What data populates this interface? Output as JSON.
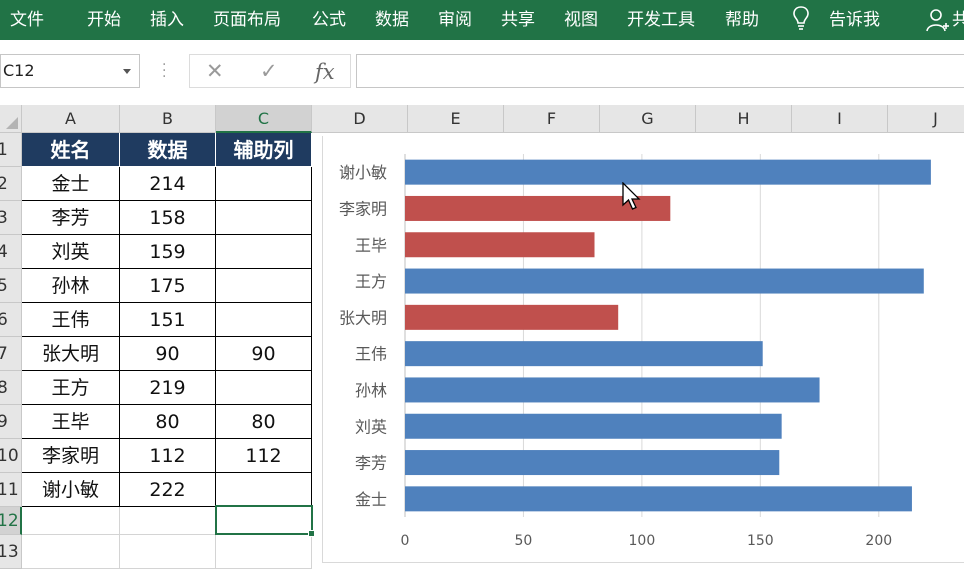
{
  "ribbon": {
    "tabs": [
      "文件",
      "开始",
      "插入",
      "页面布局",
      "公式",
      "数据",
      "审阅",
      "共享",
      "视图",
      "开发工具",
      "帮助"
    ],
    "tell_me": "告诉我",
    "share_partial": "共"
  },
  "formula_bar": {
    "name_box": "C12",
    "cancel": "✕",
    "enter": "✓",
    "fx": "fx",
    "formula": ""
  },
  "columns": [
    "A",
    "B",
    "C",
    "D",
    "E",
    "F",
    "G",
    "H",
    "I",
    "J"
  ],
  "rows": [
    "1",
    "2",
    "3",
    "4",
    "5",
    "6",
    "7",
    "8",
    "9",
    "10",
    "11",
    "12",
    "13"
  ],
  "selected_cell": {
    "column": "C",
    "row": "12"
  },
  "table": {
    "headers": [
      "姓名",
      "数据",
      "辅助列"
    ],
    "rows": [
      [
        "金士",
        "214",
        ""
      ],
      [
        "李芳",
        "158",
        ""
      ],
      [
        "刘英",
        "159",
        ""
      ],
      [
        "孙林",
        "175",
        ""
      ],
      [
        "王伟",
        "151",
        ""
      ],
      [
        "张大明",
        "90",
        "90"
      ],
      [
        "王方",
        "219",
        ""
      ],
      [
        "王毕",
        "80",
        "80"
      ],
      [
        "李家明",
        "112",
        "112"
      ],
      [
        "谢小敏",
        "222",
        ""
      ]
    ]
  },
  "chart_data": {
    "type": "bar",
    "orientation": "horizontal",
    "categories": [
      "谢小敏",
      "李家明",
      "王毕",
      "王方",
      "张大明",
      "王伟",
      "孙林",
      "刘英",
      "李芳",
      "金士"
    ],
    "values": [
      222,
      112,
      80,
      219,
      90,
      151,
      175,
      159,
      158,
      214
    ],
    "highlighted": [
      false,
      true,
      true,
      false,
      true,
      false,
      false,
      false,
      false,
      false
    ],
    "xlim": [
      0,
      225
    ],
    "xticks": [
      "0",
      "50",
      "100",
      "150",
      "200"
    ],
    "grid": true,
    "colors": {
      "normal": "#4f81bd",
      "highlight": "#c0504d",
      "grid": "#d9d9d9"
    }
  }
}
